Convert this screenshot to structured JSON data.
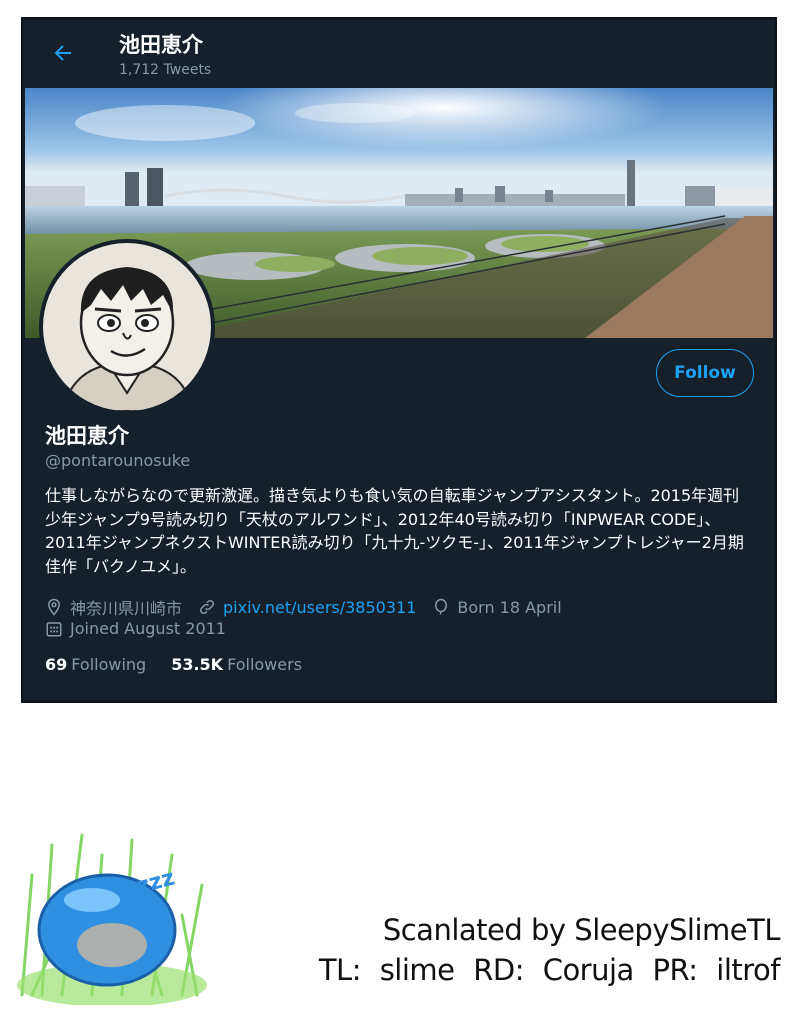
{
  "header": {
    "name": "池田恵介",
    "tweet_count": "1,712 Tweets",
    "back_icon": "arrow-left-icon"
  },
  "profile": {
    "display_name": "池田恵介",
    "handle": "@pontarounosuke",
    "bio": "仕事しながらなので更新激遅。描き気よりも食い気の自転車ジャンプアシスタント。2015年週刊少年ジャンプ9号読み切り「天杖のアルワンド」、2012年40号読み切り「INPWEAR CODE」、2011年ジャンプネクストWINTER読み切り「九十九-ツクモ-」、2011年ジャンプトレジャー2月期 佳作「バクノユメ」。",
    "location": "神奈川県川崎市",
    "website": "pixiv.net/users/3850311",
    "birthday": "Born 18 April",
    "joined": "Joined August 2011",
    "following_count": "69",
    "following_label": "Following",
    "followers_count": "53.5K",
    "followers_label": "Followers",
    "follow_button": "Follow"
  },
  "colors": {
    "background": "#15202b",
    "accent": "#1da1f2",
    "secondary_text": "#8899a6"
  },
  "credits": {
    "line1": "Scanlated by SleepySlimeTL",
    "line2": "TL: slime   RD: Coruja   PR: iltrof"
  }
}
